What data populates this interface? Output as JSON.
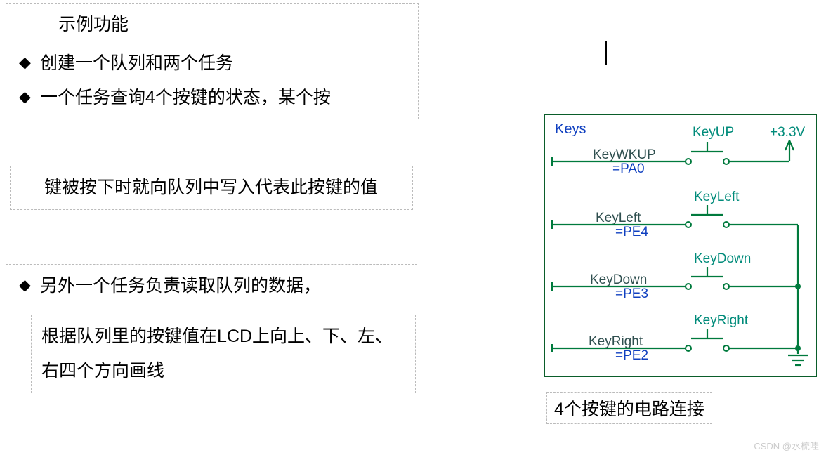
{
  "title": "示例功能",
  "bullets": {
    "b1": "创建一个队列和两个任务",
    "b2a": "一个任务查询4个按键的状态，某个按",
    "b2b": "键被按下时就向队列中写入代表此按键的值",
    "b3a": "另外一个任务负责读取队列的数据，",
    "b3b": "根据队列里的按键值在LCD上向上、下、左、右四个方向画线"
  },
  "schematic": {
    "title": "Keys",
    "voltage": "+3.3V",
    "nets": {
      "wkup": {
        "name": "KeyWKUP",
        "pin": "=PA0",
        "switch": "KeyUP"
      },
      "left": {
        "name": "KeyLeft",
        "pin": "=PE4",
        "switch": "KeyLeft"
      },
      "down": {
        "name": "KeyDown",
        "pin": "=PE3",
        "switch": "KeyDown"
      },
      "right": {
        "name": "KeyRight",
        "pin": "=PE2",
        "switch": "KeyRight"
      }
    }
  },
  "caption": "4个按键的电路连接",
  "watermark": "CSDN @水梳哇"
}
